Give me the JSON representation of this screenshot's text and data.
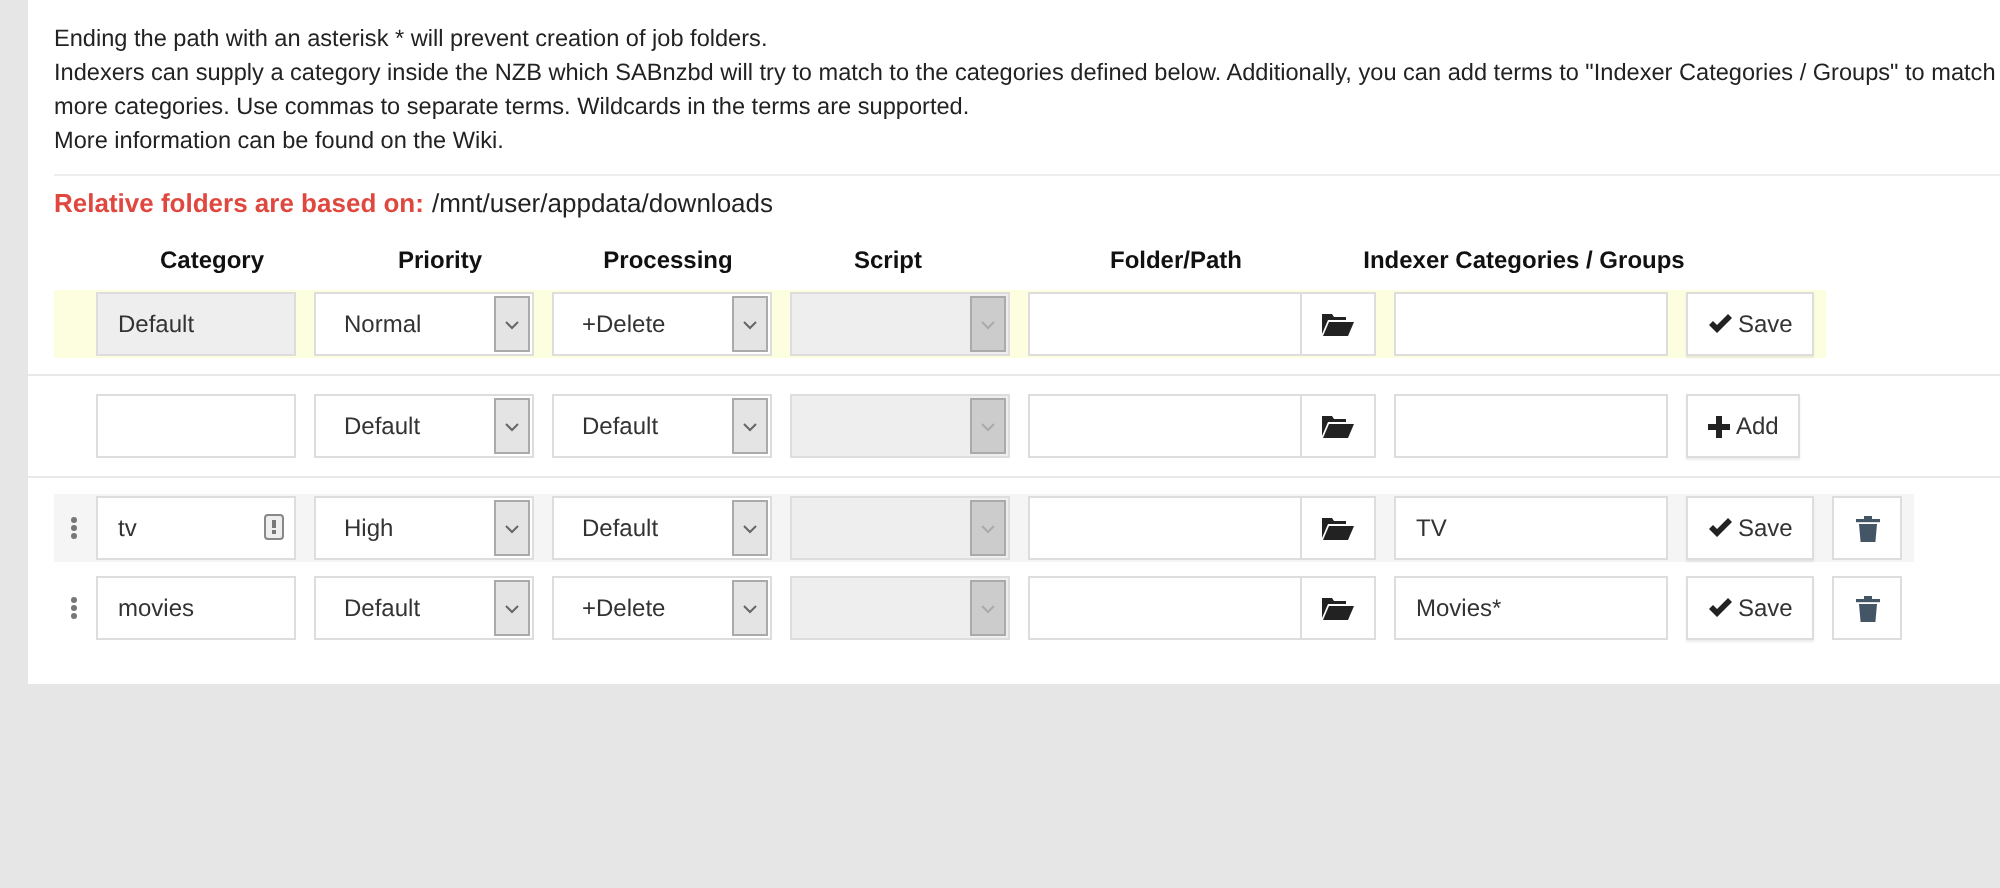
{
  "notes": [
    "Ending the path with an asterisk * will prevent creation of job folders.",
    "Indexers can supply a category inside the NZB which SABnzbd will try to match to the categories defined below. Additionally, you can add terms to \"Indexer Categories / Groups\" to match more categories. Use commas to separate terms. Wildcards in the terms are supported.",
    "More information can be found on the Wiki."
  ],
  "relative": {
    "label": "Relative folders are based on:",
    "path": "/mnt/user/appdata/downloads"
  },
  "columns": [
    "Category",
    "Priority",
    "Processing",
    "Script",
    "Folder/Path",
    "Indexer Categories / Groups"
  ],
  "rows": [
    {
      "kind": "default",
      "highlighted": true,
      "category": "Default",
      "field_icon": false,
      "priority": "Normal",
      "processing": "+Delete",
      "script_disabled": true,
      "folder": "",
      "groups": "",
      "button": "Save"
    },
    {
      "kind": "new",
      "highlighted": false,
      "category": "",
      "field_icon": false,
      "priority": "Default",
      "processing": "Default",
      "script_disabled": true,
      "folder": "",
      "groups": "",
      "button": "Add"
    },
    {
      "kind": "existing",
      "highlighted": true,
      "category": "tv",
      "field_icon": true,
      "priority": "High",
      "processing": "Default",
      "script_disabled": true,
      "folder": "",
      "groups": "TV",
      "button": "Save"
    },
    {
      "kind": "existing",
      "highlighted": false,
      "category": "movies",
      "field_icon": false,
      "priority": "Default",
      "processing": "+Delete",
      "script_disabled": true,
      "folder": "",
      "groups": "Movies*",
      "button": "Save"
    }
  ]
}
